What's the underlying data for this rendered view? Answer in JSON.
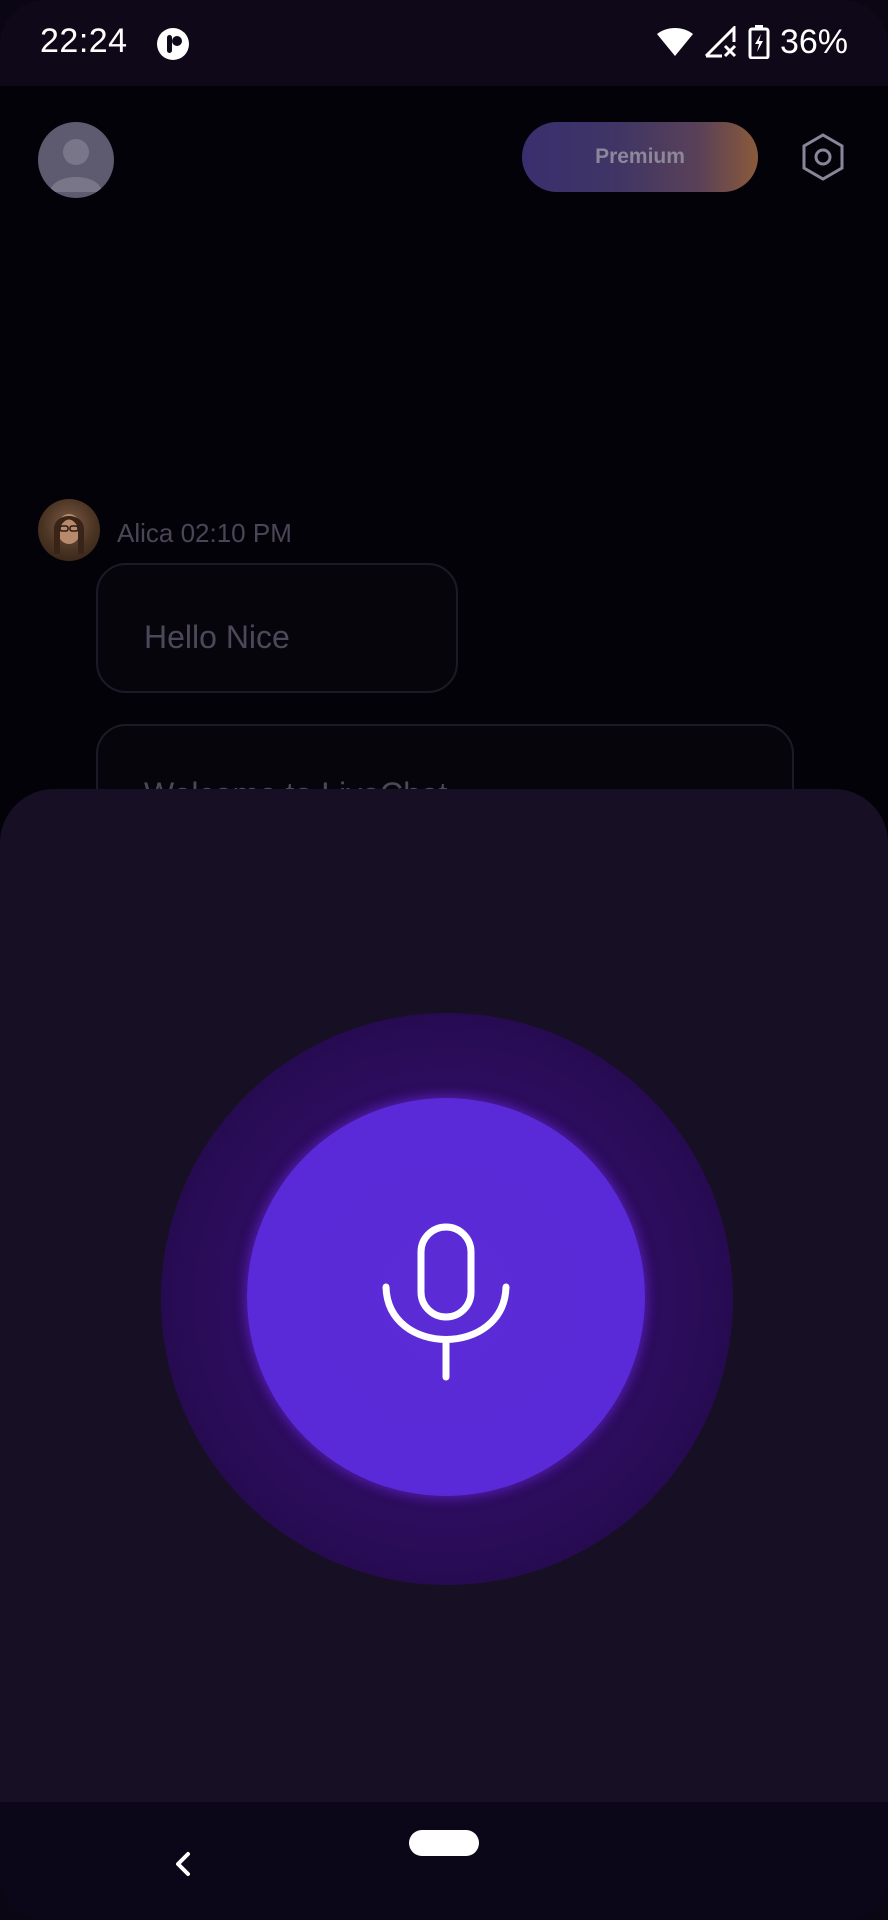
{
  "status_bar": {
    "time": "22:24",
    "battery": "36%",
    "icons": [
      "app-notification-icon",
      "wifi-icon",
      "signal-off-icon",
      "battery-charging-icon"
    ]
  },
  "header": {
    "premium_label": "Premium",
    "avatar_icon": "user-placeholder-icon",
    "settings_icon": "hexagon-settings-icon"
  },
  "chat": {
    "sender_name_time": "Alica 02:10 PM",
    "messages": [
      {
        "text": "Hello Nice"
      },
      {
        "text": "Welcome to LiveChat"
      }
    ]
  },
  "voice": {
    "mic_icon": "microphone-icon",
    "glow_color": "#2f0b63",
    "button_color": "#5b2ad8"
  },
  "nav": {
    "back_icon": "back-chevron-icon",
    "home_icon": "home-pill-icon"
  }
}
